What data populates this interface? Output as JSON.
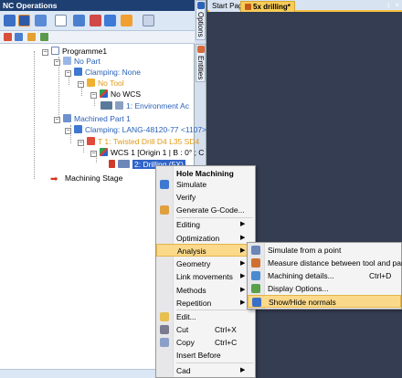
{
  "window": {
    "title": "NC Operations",
    "pin_glyph": "↕",
    "close_glyph": "×"
  },
  "toolbar_icons": [
    "operations-icon",
    "settings-icon",
    "export-icon",
    "doc-icon",
    "move-icon",
    "tool-icon",
    "fixture-icon",
    "wizard-icon",
    "grid-icon"
  ],
  "side_tabs": {
    "options": "Options",
    "entities": "Entities"
  },
  "tabs": {
    "start": "Start Page",
    "active": "5x drilling*"
  },
  "tree": {
    "root": "Programme1",
    "no_part": "No Part",
    "clamping_none": "Clamping: None",
    "no_tool": "No Tool",
    "no_wcs": "No WCS",
    "env": "1: Environment Ac",
    "machined_part": "Machined Part 1",
    "clamping": "Clamping: LANG-48120-77 <1107>",
    "tool": "T 1: Twisted Drill D4 L35 SD4",
    "wcs": "WCS 1 [Origin 1 | B : 0° ; C",
    "drilling": "2: Drilling (5X)",
    "stage": "Machining Stage"
  },
  "context_menu": {
    "header": "Hole Machining",
    "items": [
      "Simulate",
      "Verify",
      "Generate G-Code...",
      "Editing",
      "Optimization",
      "Analysis",
      "Geometry",
      "Link movements",
      "Methods",
      "Repetition",
      "Edit...",
      "Cut",
      "Copy",
      "Insert Before",
      "Cad"
    ],
    "cut_shortcut": "Ctrl+X",
    "copy_shortcut": "Ctrl+C",
    "submenu_arrow": "▶"
  },
  "analysis_menu": {
    "items": [
      "Simulate from a point",
      "Measure distance between tool and part",
      "Machining details...",
      "Display Options...",
      "Show/Hide normals"
    ],
    "details_shortcut": "Ctrl+D"
  },
  "colors": {
    "title_bar": "#1e3f72",
    "highlight": "#fbd98a",
    "viewport": "#353d52",
    "active_tab": "#f7cc58"
  }
}
